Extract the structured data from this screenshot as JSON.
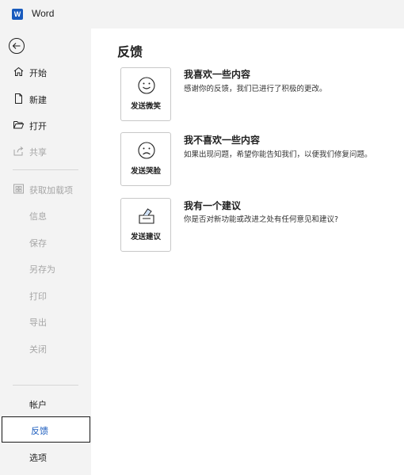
{
  "app": {
    "logo_letter": "W",
    "name": "Word"
  },
  "sidebar": {
    "items": [
      {
        "label": "开始",
        "icon": "home-icon",
        "state": "normal"
      },
      {
        "label": "新建",
        "icon": "new-document-icon",
        "state": "normal"
      },
      {
        "label": "打开",
        "icon": "folder-open-icon",
        "state": "normal"
      },
      {
        "label": "共享",
        "icon": "share-icon",
        "state": "disabled"
      },
      {
        "label": "获取加载项",
        "icon": "add-ins-icon",
        "state": "disabled"
      },
      {
        "label": "信息",
        "state": "disabled"
      },
      {
        "label": "保存",
        "state": "disabled"
      },
      {
        "label": "另存为",
        "state": "disabled"
      },
      {
        "label": "打印",
        "state": "disabled"
      },
      {
        "label": "导出",
        "state": "disabled"
      },
      {
        "label": "关闭",
        "state": "disabled"
      }
    ],
    "bottom_items": [
      {
        "label": "帐户",
        "state": "normal"
      },
      {
        "label": "反馈",
        "state": "selected"
      },
      {
        "label": "选项",
        "state": "normal"
      }
    ]
  },
  "main": {
    "title": "反馈",
    "cards": [
      {
        "button_label": "发送微笑",
        "icon": "smile-face-icon",
        "heading": "我喜欢一些内容",
        "description": "感谢你的反馈，我们已进行了积极的更改。"
      },
      {
        "button_label": "发送哭脸",
        "icon": "frown-face-icon",
        "heading": "我不喜欢一些内容",
        "description": "如果出现问题，希望你能告知我们，以便我们修复问题。"
      },
      {
        "button_label": "发送建议",
        "icon": "suggestion-box-icon",
        "heading": "我有一个建议",
        "description": "你是否对新功能或改进之处有任何意见和建议?"
      }
    ]
  },
  "colors": {
    "accent": "#185abd",
    "disabled_text": "#a6a6a6",
    "sidebar_bg": "#f3f3f3"
  }
}
